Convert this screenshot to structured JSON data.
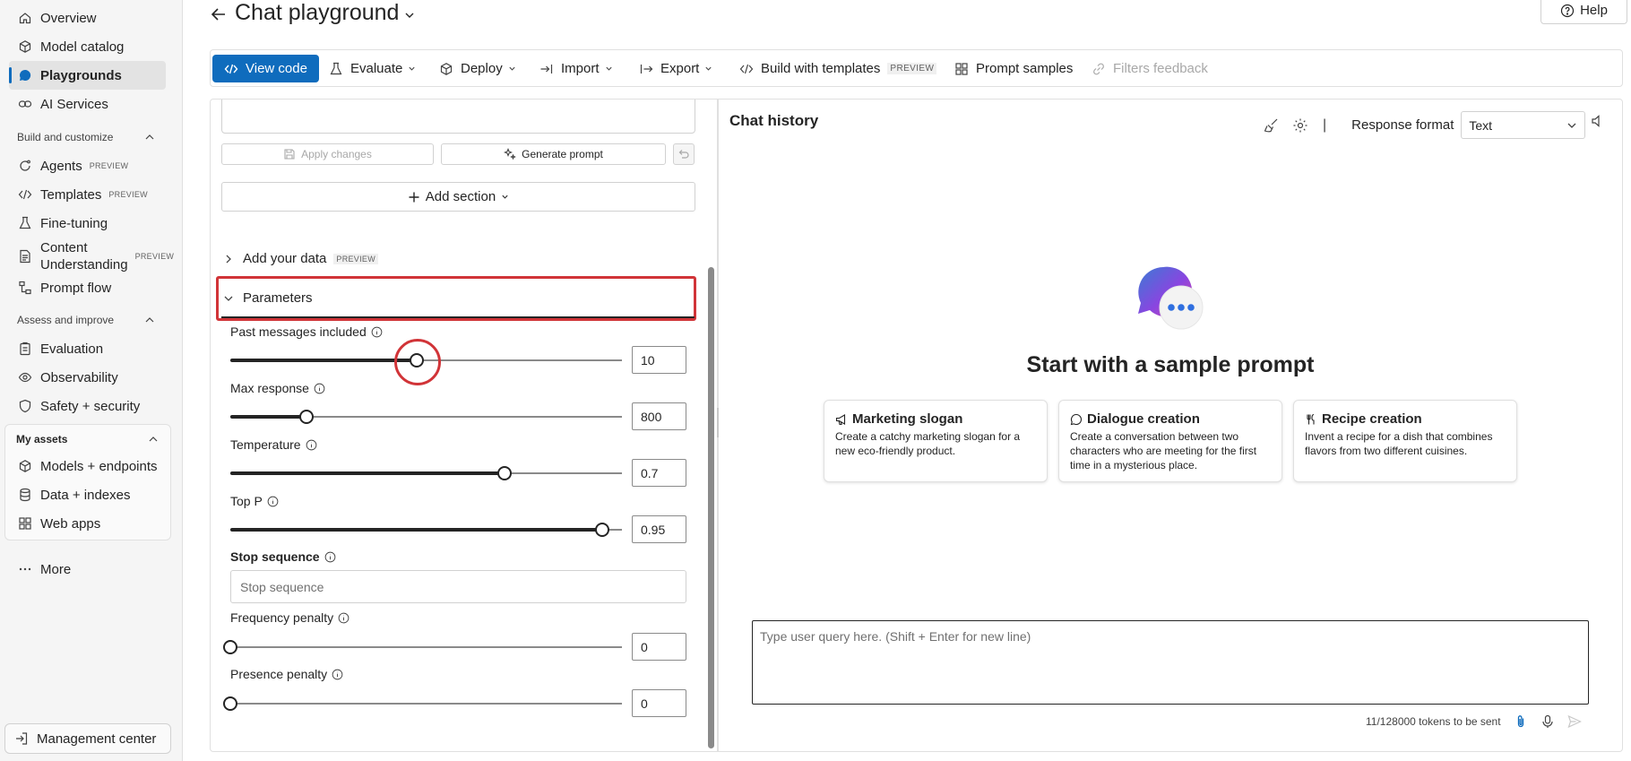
{
  "sidebar": {
    "items_top": [
      {
        "label": "Overview",
        "icon": "home-icon"
      },
      {
        "label": "Model catalog",
        "icon": "cube-icon"
      },
      {
        "label": "Playgrounds",
        "icon": "chat-bubble-icon",
        "active": true
      },
      {
        "label": "AI Services",
        "icon": "link-icon"
      }
    ],
    "section_build": "Build and customize",
    "items_build": [
      {
        "label": "Agents",
        "badge": "PREVIEW",
        "icon": "agent-icon"
      },
      {
        "label": "Templates",
        "badge": "PREVIEW",
        "icon": "code-icon"
      },
      {
        "label": "Fine-tuning",
        "icon": "flask-icon"
      },
      {
        "label_line1": "Content",
        "label_line2": "Understanding",
        "badge": "PREVIEW",
        "icon": "document-icon"
      },
      {
        "label": "Prompt flow",
        "icon": "flow-icon"
      }
    ],
    "section_assess": "Assess and improve",
    "items_assess": [
      {
        "label": "Evaluation",
        "icon": "clipboard-icon"
      },
      {
        "label": "Observability",
        "icon": "eye-icon"
      },
      {
        "label": "Safety + security",
        "icon": "shield-icon"
      }
    ],
    "section_assets": "My assets",
    "items_assets": [
      {
        "label": "Models + endpoints",
        "icon": "cube-icon"
      },
      {
        "label": "Data + indexes",
        "icon": "database-icon"
      },
      {
        "label": "Web apps",
        "icon": "grid-icon"
      }
    ],
    "more": "More",
    "management": "Management center"
  },
  "header": {
    "title": "Chat playground",
    "help": "Help"
  },
  "toolbar": {
    "view_code": "View code",
    "evaluate": "Evaluate",
    "deploy": "Deploy",
    "import": "Import",
    "export": "Export",
    "build_templates": "Build with templates",
    "build_templates_badge": "PREVIEW",
    "prompt_samples": "Prompt samples",
    "filters_feedback": "Filters feedback"
  },
  "config": {
    "apply_changes": "Apply changes",
    "generate_prompt": "Generate prompt",
    "add_section": "Add section",
    "add_your_data": "Add your data",
    "add_your_data_badge": "PREVIEW",
    "parameters": "Parameters",
    "past_messages": {
      "label": "Past messages included",
      "value": "10",
      "fraction": 0.475
    },
    "max_response": {
      "label": "Max response",
      "value": "800",
      "fraction": 0.195
    },
    "temperature": {
      "label": "Temperature",
      "value": "0.7",
      "fraction": 0.7
    },
    "top_p": {
      "label": "Top P",
      "value": "0.95",
      "fraction": 0.95
    },
    "stop_sequence": {
      "label": "Stop sequence",
      "placeholder": "Stop sequence"
    },
    "frequency_penalty": {
      "label": "Frequency penalty",
      "value": "0",
      "fraction": 0
    },
    "presence_penalty": {
      "label": "Presence penalty",
      "value": "0",
      "fraction": 0
    }
  },
  "chat": {
    "title": "Chat history",
    "response_format_label": "Response format",
    "response_format_value": "Text",
    "empty_title": "Start with a sample prompt",
    "samples": [
      {
        "title": "Marketing slogan",
        "desc": "Create a catchy marketing slogan for a new eco-friendly product.",
        "icon": "megaphone-icon"
      },
      {
        "title": "Dialogue creation",
        "desc": "Create a conversation between two characters who are meeting for the first time in a mysterious place.",
        "icon": "speech-bubble-icon"
      },
      {
        "title": "Recipe creation",
        "desc": "Invent a recipe for a dish that combines flavors from two different cuisines.",
        "icon": "utensils-icon"
      }
    ],
    "query_placeholder": "Type user query here. (Shift + Enter for new line)",
    "tokens": "11/128000 tokens to be sent"
  },
  "colors": {
    "accent": "#0f6cbd",
    "highlight_red": "#d13438",
    "sidebar_bg": "#f5f5f5"
  }
}
